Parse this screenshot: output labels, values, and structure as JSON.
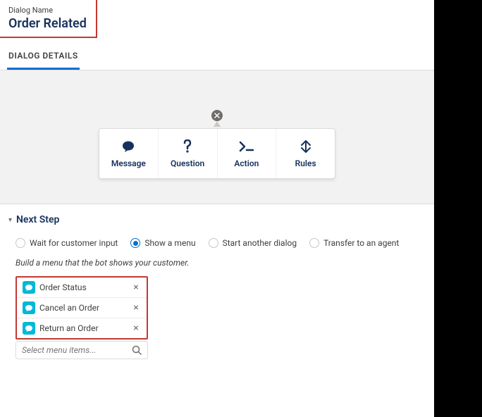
{
  "header": {
    "label": "Dialog Name",
    "title": "Order Related"
  },
  "tab": {
    "label": "DIALOG DETAILS"
  },
  "card": {
    "items": [
      {
        "label": "Message"
      },
      {
        "label": "Question"
      },
      {
        "label": "Action"
      },
      {
        "label": "Rules"
      }
    ]
  },
  "next_step": {
    "title": "Next Step",
    "options": [
      {
        "label": "Wait for customer input"
      },
      {
        "label": "Show a menu"
      },
      {
        "label": "Start another dialog"
      },
      {
        "label": "Transfer to an agent"
      }
    ],
    "hint": "Build a menu that the bot shows your customer.",
    "menu_items": [
      {
        "label": "Order Status"
      },
      {
        "label": "Cancel an Order"
      },
      {
        "label": "Return an Order"
      }
    ],
    "search_placeholder": "Select menu items..."
  }
}
